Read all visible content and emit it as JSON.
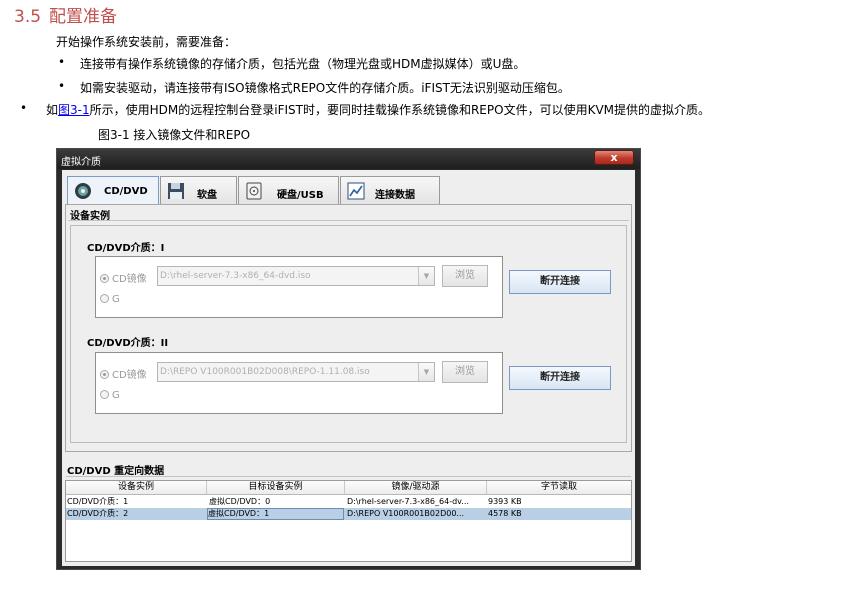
{
  "heading": {
    "number": "3.5",
    "title": "配置准备"
  },
  "intro": "开始操作系统安装前，需要准备：",
  "bullets": [
    {
      "dot": "•",
      "text": "连接带有操作系统镜像的存储介质，包括光盘（物理光盘或HDM虚拟媒体）或U盘。"
    },
    {
      "dot": "•",
      "text": "如需安装驱动，请连接带有ISO镜像格式REPO文件的存储介质。iFIST无法识别驱动压缩包。"
    },
    {
      "dot": "•",
      "prefix": "如",
      "link": "图3-1",
      "text": "所示，使用HDM的远程控制台登录iFIST时，要同时挂载操作系统镜像和REPO文件，可以使用KVM提供的虚拟介质。"
    }
  ],
  "caption": "图3-1 接入镜像文件和REPO",
  "dialog": {
    "title": "虚拟介质",
    "close_label": "x",
    "tabs": [
      {
        "label": "CD/DVD",
        "icon": "cd-icon"
      },
      {
        "label": "软盘",
        "icon": "floppy-icon"
      },
      {
        "label": "硬盘/USB",
        "icon": "hdd-icon"
      },
      {
        "label": "连接数据",
        "icon": "chart-icon"
      }
    ],
    "device_section": "设备实例",
    "groups": [
      {
        "label": "CD/DVD介质：I",
        "radio_image": "CD镜像",
        "radio_g": "G",
        "path": "D:\\rhel-server-7.3-x86_64-dvd.iso",
        "browse": "浏览",
        "disconnect": "断开连接"
      },
      {
        "label": "CD/DVD介质：II",
        "radio_image": "CD镜像",
        "radio_g": "G",
        "path": "D:\\REPO V100R001B02D008\\REPO-1.11.08.iso",
        "browse": "浏览",
        "disconnect": "断开连接"
      }
    ],
    "redirect_section": "CD/DVD 重定向数据",
    "table": {
      "headers": [
        "设备实例",
        "目标设备实例",
        "镜像/驱动源",
        "字节读取"
      ],
      "rows": [
        [
          "CD/DVD介质：1",
          "虚拟CD/DVD：0",
          "D:\\rhel-server-7.3-x86_64-dv...",
          "9393 KB"
        ],
        [
          "CD/DVD介质：2",
          "虚拟CD/DVD：1",
          "D:\\REPO V100R001B02D00...",
          "4578 KB"
        ]
      ]
    }
  }
}
